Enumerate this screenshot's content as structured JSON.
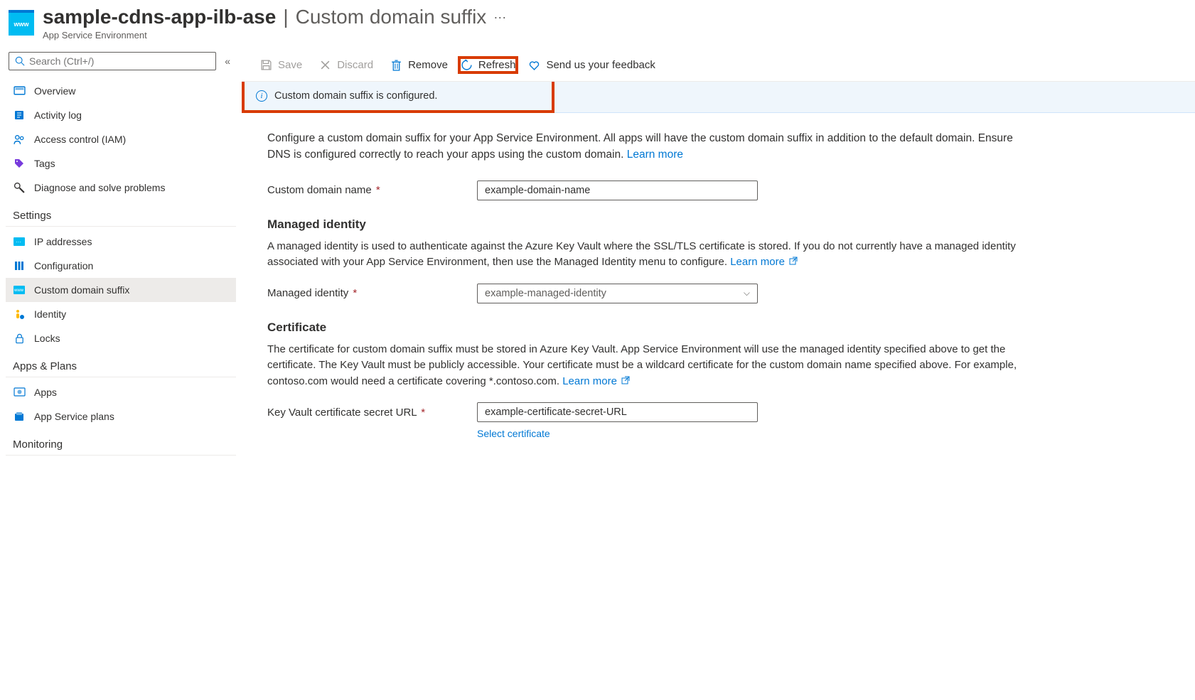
{
  "header": {
    "resource_name": "sample-cdns-app-ilb-ase",
    "separator": "|",
    "page_title": "Custom domain suffix",
    "subtitle": "App Service Environment"
  },
  "search": {
    "placeholder": "Search (Ctrl+/)"
  },
  "nav": {
    "overview": "Overview",
    "activity_log": "Activity log",
    "access_control": "Access control (IAM)",
    "tags": "Tags",
    "diagnose": "Diagnose and solve problems",
    "section_settings": "Settings",
    "ip_addresses": "IP addresses",
    "configuration": "Configuration",
    "custom_domain_suffix": "Custom domain suffix",
    "identity": "Identity",
    "locks": "Locks",
    "section_apps": "Apps & Plans",
    "apps": "Apps",
    "app_service_plans": "App Service plans",
    "section_monitoring": "Monitoring"
  },
  "toolbar": {
    "save": "Save",
    "discard": "Discard",
    "remove": "Remove",
    "refresh": "Refresh",
    "feedback": "Send us your feedback"
  },
  "info_bar": "Custom domain suffix is configured.",
  "main": {
    "description": "Configure a custom domain suffix for your App Service Environment. All apps will have the custom domain suffix in addition to the default domain. Ensure DNS is configured correctly to reach your apps using the custom domain. ",
    "learn_more": "Learn more",
    "custom_domain_label": "Custom domain name",
    "custom_domain_value": "example-domain-name",
    "managed_identity_title": "Managed identity",
    "managed_identity_desc": "A managed identity is used to authenticate against the Azure Key Vault where the SSL/TLS certificate is stored. If you do not currently have a managed identity associated with your App Service Environment, then use the Managed Identity menu to configure. ",
    "managed_identity_label": "Managed identity",
    "managed_identity_value": "example-managed-identity",
    "certificate_title": "Certificate",
    "certificate_desc": "The certificate for custom domain suffix must be stored in Azure Key Vault. App Service Environment will use the managed identity specified above to get the certificate. The Key Vault must be publicly accessible. Your certificate must be a wildcard certificate for the custom domain name specified above. For example, contoso.com would need a certificate covering *.contoso.com. ",
    "keyvault_label": "Key Vault certificate secret URL",
    "keyvault_value": "example-certificate-secret-URL",
    "select_certificate": "Select certificate"
  }
}
